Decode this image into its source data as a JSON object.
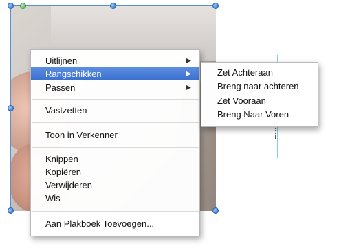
{
  "context_menu": {
    "items": [
      {
        "label": "Uitlijnen",
        "submenu": true
      },
      {
        "label": "Rangschikken",
        "submenu": true,
        "highlighted": true
      },
      {
        "label": "Passen",
        "submenu": true
      },
      {
        "label": "Vastzetten"
      },
      {
        "label": "Toon in Verkenner"
      },
      {
        "label": "Knippen"
      },
      {
        "label": "Kopiëren"
      },
      {
        "label": "Verwijderen"
      },
      {
        "label": "Wis"
      },
      {
        "label": "Aan Plakboek Toevoegen..."
      }
    ],
    "submenu_arrow": "▶",
    "highlight_color": "#3a6fd0"
  },
  "submenu": {
    "items": [
      {
        "label": "Zet Achteraan"
      },
      {
        "label": "Breng naar achteren"
      },
      {
        "label": "Zet Vooraan"
      },
      {
        "label": "Breng Naar Voren"
      }
    ]
  },
  "selection": {
    "handle_color": "#3c7fd6",
    "rotate_handle_color": "#5fb261"
  },
  "icons": {
    "submenu_arrow_icon": "right-triangle"
  }
}
